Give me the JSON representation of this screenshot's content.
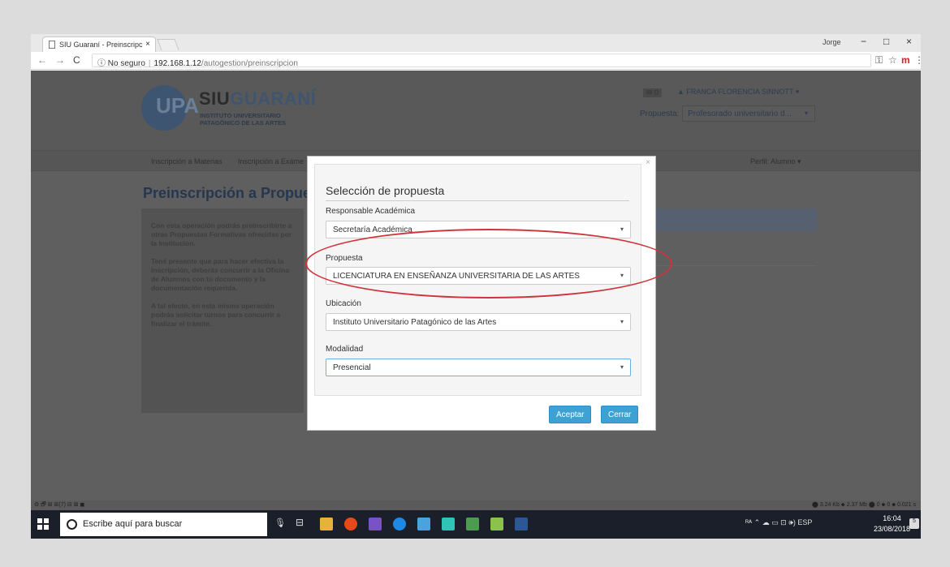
{
  "browser": {
    "tab_title": "SIU Guaraní - Preinscripc",
    "tab_close": "×",
    "window_user": "Jorge",
    "window_controls": [
      "−",
      "□",
      "×"
    ],
    "security_label": "ⓘ No seguro",
    "url_host": "192.168.1.12",
    "url_path": "/autogestion/preinscripcion",
    "nav_back": "←",
    "nav_forward": "→",
    "nav_reload": "C",
    "key_icon": "⚿",
    "star_icon": "☆",
    "extension_label": "m",
    "menu_icon": "⋮"
  },
  "header": {
    "logo_glyph": "UPA",
    "logo_title_a": "SIU",
    "logo_title_b": "GUARANÍ",
    "logo_sub_1": "INSTITUTO UNIVERSITARIO",
    "logo_sub_2": "PATAGÓNICO DE LAS ARTES",
    "mail_badge": "✉ 0",
    "user_name": "▲ FRANCA FLORENCIA SINNOTT ▾",
    "propuesta_label": "Propuesta:",
    "propuesta_value": "Profesorado universitario d...",
    "propuesta_caret": "▾"
  },
  "menu": {
    "items": [
      "Inscripción a Materias",
      "Inscripción a Exáme"
    ],
    "profile": "Perfil: Alumno ▾"
  },
  "page": {
    "title": "Preinscripción a Propues",
    "info_p1": "Con esta operación podrás preinscribirte a otras Propuestas Formativas ofrecidas por la Institución.",
    "info_p2": "Tené presente que para hacer efectiva la inscripción, deberás concurrir a la Oficina de Alumnos con tu documento y la documentación requerida.",
    "info_p3": "A tal efecto, en esta misma operación podrás solicitar turnos para concurrir a finalizar el trámite."
  },
  "modal": {
    "close": "×",
    "title": "Selección de propuesta",
    "fields": [
      {
        "label": "Responsable Académica",
        "value": "Secretaría Académica"
      },
      {
        "label": "Propuesta",
        "value": "LICENCIATURA EN ENSEÑANZA UNIVERSITARIA DE LAS ARTES"
      },
      {
        "label": "Ubicación",
        "value": "Instituto Universitario Patagónico de las Artes"
      },
      {
        "label": "Modalidad",
        "value": "Presencial"
      }
    ],
    "caret": "▾",
    "accept_label": "Aceptar",
    "close_label": "Cerrar",
    "highlight_color": "#d0323a",
    "accent_color": "#3ea1d3"
  },
  "statusbar": {
    "left": "⚙ 🗗 ⊞ ⊞(7) ⊟ ⊠ ◼",
    "right": "⬤ 3.24 Kb ⬥ 2.37 Mb ⬤ 0 ⬥ 0 ⬥ 0.021 s"
  },
  "taskbar": {
    "search_placeholder": "Escribe aquí para buscar",
    "tray_text": "ᴿᴬ  ⌃  ☁ ▭ ⊡ 🕪)  ESP",
    "time": "16:04",
    "date": "23/08/2018",
    "notif_count": "5",
    "mic_icon": "🎙",
    "taskview_icon": "⊟"
  }
}
